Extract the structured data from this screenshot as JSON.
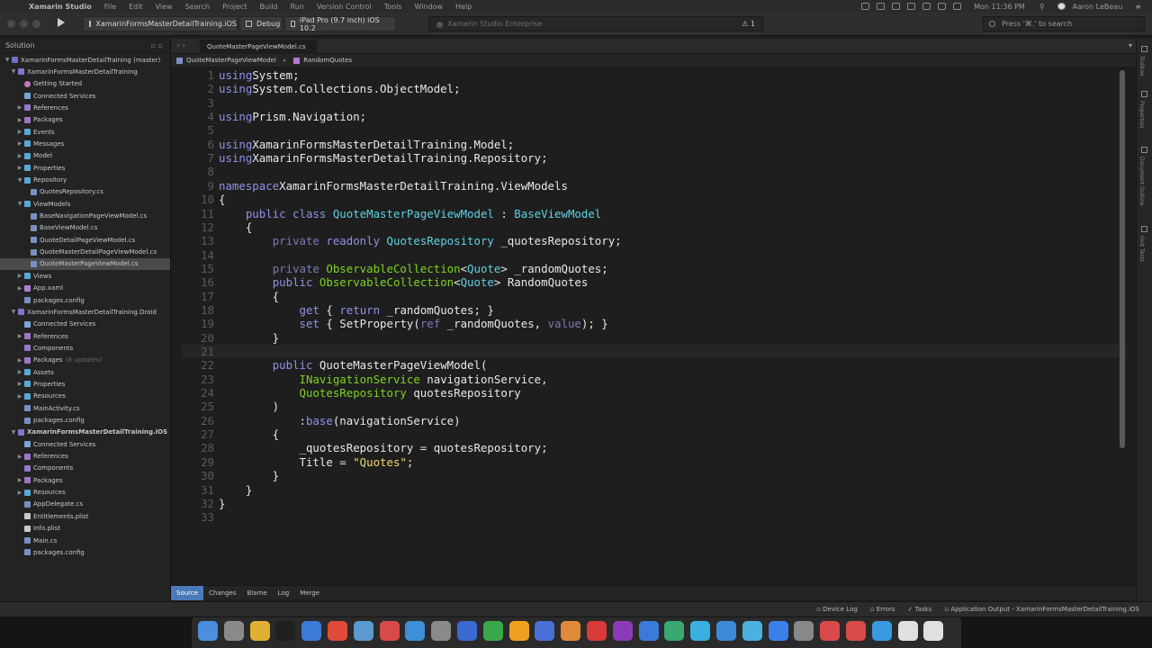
{
  "menubar": {
    "app_name": "Xamarin Studio",
    "items": [
      "File",
      "Edit",
      "View",
      "Search",
      "Project",
      "Build",
      "Run",
      "Version Control",
      "Tools",
      "Window",
      "Help"
    ],
    "clock": "Mon 11:36 PM",
    "user": "Aaron LeBeau"
  },
  "toolbar": {
    "project": "XamarinFormsMasterDetailTraining.iOS",
    "config": "Debug",
    "device": "iPad Pro (9.7 inch) iOS 10.2",
    "status": "Xamarin Studio Enterprise",
    "warnings": "1",
    "search_placeholder": "Press '⌘.' to search"
  },
  "sidebar": {
    "title": "Solution",
    "nodes": [
      {
        "label": "XamarinFormsMasterDetailTraining (master)",
        "indent": 0,
        "arrow": "▼",
        "icon": "sol"
      },
      {
        "label": "XamarinFormsMasterDetailTraining",
        "indent": 1,
        "arrow": "▼",
        "icon": "proj"
      },
      {
        "label": "Getting Started",
        "indent": 2,
        "arrow": "",
        "icon": "gear"
      },
      {
        "label": "Connected Services",
        "indent": 2,
        "arrow": "",
        "icon": "svc"
      },
      {
        "label": "References",
        "indent": 2,
        "arrow": "▶",
        "icon": "pfolder"
      },
      {
        "label": "Packages",
        "indent": 2,
        "arrow": "▶",
        "icon": "pfolder"
      },
      {
        "label": "Events",
        "indent": 2,
        "arrow": "▶",
        "icon": "folder"
      },
      {
        "label": "Messages",
        "indent": 2,
        "arrow": "▶",
        "icon": "folder"
      },
      {
        "label": "Model",
        "indent": 2,
        "arrow": "▶",
        "icon": "folder"
      },
      {
        "label": "Properties",
        "indent": 2,
        "arrow": "▶",
        "icon": "folder"
      },
      {
        "label": "Repository",
        "indent": 2,
        "arrow": "▼",
        "icon": "folder"
      },
      {
        "label": "QuotesRepository.cs",
        "indent": 3,
        "arrow": "",
        "icon": "file"
      },
      {
        "label": "ViewModels",
        "indent": 2,
        "arrow": "▼",
        "icon": "folder"
      },
      {
        "label": "BaseNavigationPageViewModel.cs",
        "indent": 3,
        "arrow": "",
        "icon": "file"
      },
      {
        "label": "BaseViewModel.cs",
        "indent": 3,
        "arrow": "",
        "icon": "file"
      },
      {
        "label": "QuoteDetailPageViewModel.cs",
        "indent": 3,
        "arrow": "",
        "icon": "file"
      },
      {
        "label": "QuoteMasterDetailPageViewModel.cs",
        "indent": 3,
        "arrow": "",
        "icon": "file"
      },
      {
        "label": "QuoteMasterPageViewModel.cs",
        "indent": 3,
        "arrow": "",
        "icon": "file",
        "selected": true
      },
      {
        "label": "Views",
        "indent": 2,
        "arrow": "▶",
        "icon": "folder"
      },
      {
        "label": "App.xaml",
        "indent": 2,
        "arrow": "▶",
        "icon": "xaml"
      },
      {
        "label": "packages.config",
        "indent": 2,
        "arrow": "",
        "icon": "file"
      },
      {
        "label": "XamarinFormsMasterDetailTraining.Droid",
        "indent": 1,
        "arrow": "▼",
        "icon": "proj"
      },
      {
        "label": "Connected Services",
        "indent": 2,
        "arrow": "",
        "icon": "svc"
      },
      {
        "label": "References",
        "indent": 2,
        "arrow": "▶",
        "icon": "pfolder"
      },
      {
        "label": "Components",
        "indent": 2,
        "arrow": "",
        "icon": "pfolder"
      },
      {
        "label": "Packages",
        "indent": 2,
        "arrow": "▶",
        "icon": "pfolder",
        "extra": "(8 updates)"
      },
      {
        "label": "Assets",
        "indent": 2,
        "arrow": "▶",
        "icon": "folder"
      },
      {
        "label": "Properties",
        "indent": 2,
        "arrow": "▶",
        "icon": "folder"
      },
      {
        "label": "Resources",
        "indent": 2,
        "arrow": "▶",
        "icon": "folder"
      },
      {
        "label": "MainActivity.cs",
        "indent": 2,
        "arrow": "",
        "icon": "file"
      },
      {
        "label": "packages.config",
        "indent": 2,
        "arrow": "",
        "icon": "file"
      },
      {
        "label": "XamarinFormsMasterDetailTraining.iOS",
        "indent": 1,
        "arrow": "▼",
        "icon": "proj",
        "bold": true
      },
      {
        "label": "Connected Services",
        "indent": 2,
        "arrow": "",
        "icon": "svc"
      },
      {
        "label": "References",
        "indent": 2,
        "arrow": "▶",
        "icon": "pfolder"
      },
      {
        "label": "Components",
        "indent": 2,
        "arrow": "",
        "icon": "pfolder"
      },
      {
        "label": "Packages",
        "indent": 2,
        "arrow": "▶",
        "icon": "pfolder"
      },
      {
        "label": "Resources",
        "indent": 2,
        "arrow": "▶",
        "icon": "folder"
      },
      {
        "label": "AppDelegate.cs",
        "indent": 2,
        "arrow": "",
        "icon": "file"
      },
      {
        "label": "Entitlements.plist",
        "indent": 2,
        "arrow": "",
        "icon": "plist"
      },
      {
        "label": "Info.plist",
        "indent": 2,
        "arrow": "",
        "icon": "plist"
      },
      {
        "label": "Main.cs",
        "indent": 2,
        "arrow": "",
        "icon": "file"
      },
      {
        "label": "packages.config",
        "indent": 2,
        "arrow": "",
        "icon": "file"
      }
    ]
  },
  "editor": {
    "tab": "QuoteMasterPageViewModel.cs",
    "breadcrumb": [
      "QuoteMasterPageViewModel",
      "RandomQuotes"
    ],
    "current_line": 21,
    "lines": [
      [
        [
          "k",
          "using"
        ],
        [
          "",
          "System;"
        ]
      ],
      [
        [
          "k",
          "using"
        ],
        [
          "",
          "System.Collections.ObjectModel;"
        ]
      ],
      [],
      [
        [
          "k",
          "using"
        ],
        [
          "",
          "Prism.Navigation;"
        ]
      ],
      [],
      [
        [
          "k",
          "using"
        ],
        [
          "",
          "XamarinFormsMasterDetailTraining.Model;"
        ]
      ],
      [
        [
          "k",
          "using"
        ],
        [
          "",
          "XamarinFormsMasterDetailTraining.Repository;"
        ]
      ],
      [],
      [
        [
          "k",
          "namespace"
        ],
        [
          "",
          "XamarinFormsMasterDetailTraining.ViewModels"
        ]
      ],
      [
        [
          "",
          "{"
        ]
      ],
      [
        [
          "",
          "    "
        ],
        [
          "k",
          "public class"
        ],
        [
          "",
          ""
        ],
        [
          "t",
          "QuoteMasterPageViewModel"
        ],
        [
          "",
          " : "
        ],
        [
          "t",
          "BaseViewModel"
        ]
      ],
      [
        [
          "",
          "    {"
        ]
      ],
      [
        [
          "",
          "        "
        ],
        [
          "p",
          "private"
        ],
        [
          "",
          ""
        ],
        [
          "k",
          "readonly"
        ],
        [
          "",
          ""
        ],
        [
          "t",
          "QuotesRepository"
        ],
        [
          "",
          " _quotesRepository;"
        ]
      ],
      [],
      [
        [
          "",
          "        "
        ],
        [
          "p",
          "private"
        ],
        [
          "",
          ""
        ],
        [
          "g",
          "ObservableCollection"
        ],
        [
          "",
          "<"
        ],
        [
          "t",
          "Quote"
        ],
        [
          "",
          "> _randomQuotes;"
        ]
      ],
      [
        [
          "",
          "        "
        ],
        [
          "k",
          "public"
        ],
        [
          "",
          ""
        ],
        [
          "g",
          "ObservableCollection"
        ],
        [
          "",
          "<"
        ],
        [
          "t",
          "Quote"
        ],
        [
          "",
          "> RandomQuotes"
        ]
      ],
      [
        [
          "",
          "        {"
        ]
      ],
      [
        [
          "",
          "            "
        ],
        [
          "k",
          "get"
        ],
        [
          "",
          " { "
        ],
        [
          "k",
          "return"
        ],
        [
          "",
          " _randomQuotes; }"
        ]
      ],
      [
        [
          "",
          "            "
        ],
        [
          "k",
          "set"
        ],
        [
          "",
          " { SetProperty("
        ],
        [
          "p",
          "ref"
        ],
        [
          "",
          " _randomQuotes, "
        ],
        [
          "p",
          "value"
        ],
        [
          "",
          "); }"
        ]
      ],
      [
        [
          "",
          "        }"
        ]
      ],
      [],
      [
        [
          "",
          "        "
        ],
        [
          "k",
          "public"
        ],
        [
          "",
          " QuoteMasterPageViewModel("
        ]
      ],
      [
        [
          "",
          "            "
        ],
        [
          "g",
          "INavigationService"
        ],
        [
          "",
          " navigationService,"
        ]
      ],
      [
        [
          "",
          "            "
        ],
        [
          "g",
          "QuotesRepository"
        ],
        [
          "",
          " quotesRepository"
        ]
      ],
      [
        [
          "",
          "        )"
        ]
      ],
      [
        [
          "",
          "            :"
        ],
        [
          "k",
          "base"
        ],
        [
          "",
          "(navigationService)"
        ]
      ],
      [
        [
          "",
          "        {"
        ]
      ],
      [
        [
          "",
          "            _quotesRepository = quotesRepository;"
        ]
      ],
      [
        [
          "",
          "            Title = "
        ],
        [
          "s",
          "\"Quotes\""
        ],
        [
          "",
          ";"
        ]
      ],
      [
        [
          "",
          "        }"
        ]
      ],
      [
        [
          "",
          "    }"
        ]
      ],
      [
        [
          "",
          "}"
        ]
      ],
      []
    ]
  },
  "bottom_tabs": [
    "Source",
    "Changes",
    "Blame",
    "Log",
    "Merge"
  ],
  "right_rail": [
    "Toolbox",
    "Properties",
    "Document Outline",
    "Unit Tests"
  ],
  "statusbar": [
    "Device Log",
    "Errors",
    "Tasks",
    "Application Output - XamarinFormsMasterDetailTraining.iOS"
  ],
  "dock_colors": [
    "#4b8ee0",
    "#8a8a8a",
    "#e0b030",
    "#202020",
    "#3b7ad8",
    "#e04a3a",
    "#5a9ad0",
    "#d84a4a",
    "#3c8fd8",
    "#8a8a8a",
    "#3a6ad0",
    "#3aa84a",
    "#f0a020",
    "#4a70d8",
    "#e08a3a",
    "#d83a3a",
    "#8a3ab8",
    "#3a7ad8",
    "#3aa870",
    "#3ab0e0",
    "#3a8ad8",
    "#4ab0e0",
    "#3a80e8",
    "#888888",
    "#d84a4a",
    "#d84a4a",
    "#3a9ae0",
    "#e0e0e0",
    "#e0e0e0"
  ]
}
